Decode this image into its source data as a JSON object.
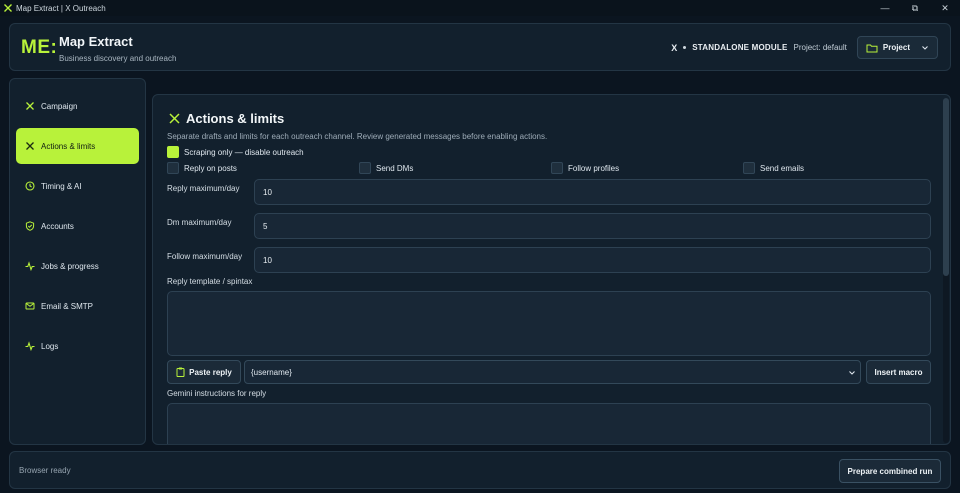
{
  "window": {
    "title": "Map Extract | X Outreach",
    "minimize": "—",
    "maximize": "⧉",
    "close": "✕"
  },
  "header": {
    "logo": "ME:",
    "title": "Map Extract",
    "subtitle": "Business discovery and outreach",
    "module_x": "X",
    "module_label": "STANDALONE MODULE",
    "project_text": "Project: default",
    "project_button": "Project"
  },
  "sidebar": {
    "items": [
      {
        "label": "Campaign",
        "icon": "x-icon"
      },
      {
        "label": "Actions & limits",
        "icon": "x-icon",
        "active": true
      },
      {
        "label": "Timing & AI",
        "icon": "clock-icon"
      },
      {
        "label": "Accounts",
        "icon": "shield-check-icon"
      },
      {
        "label": "Jobs & progress",
        "icon": "pulse-icon"
      },
      {
        "label": "Email & SMTP",
        "icon": "mail-icon"
      },
      {
        "label": "Logs",
        "icon": "pulse-icon"
      }
    ]
  },
  "main": {
    "title": "Actions & limits",
    "description": "Separate drafts and limits for each outreach channel. Review generated messages before enabling actions.",
    "scraping_only": {
      "label": "Scraping only — disable outreach",
      "checked": true
    },
    "actions": [
      {
        "label": "Reply on posts",
        "checked": false
      },
      {
        "label": "Send DMs",
        "checked": false
      },
      {
        "label": "Follow profiles",
        "checked": false
      },
      {
        "label": "Send emails",
        "checked": false
      }
    ],
    "reply_max_label": "Reply maximum/day",
    "reply_max_value": "10",
    "dm_max_label": "Dm maximum/day",
    "dm_max_value": "5",
    "follow_max_label": "Follow maximum/day",
    "follow_max_value": "10",
    "reply_template_label": "Reply template / spintax",
    "paste_reply": "Paste reply",
    "macro_selected": "{username}",
    "insert_macro": "Insert macro",
    "gemini_label": "Gemini instructions for reply"
  },
  "footer": {
    "status": "Browser ready",
    "run_button": "Prepare combined run"
  },
  "colors": {
    "accent": "#b8f23a",
    "background": "#0b1520",
    "panel": "#12202d"
  }
}
